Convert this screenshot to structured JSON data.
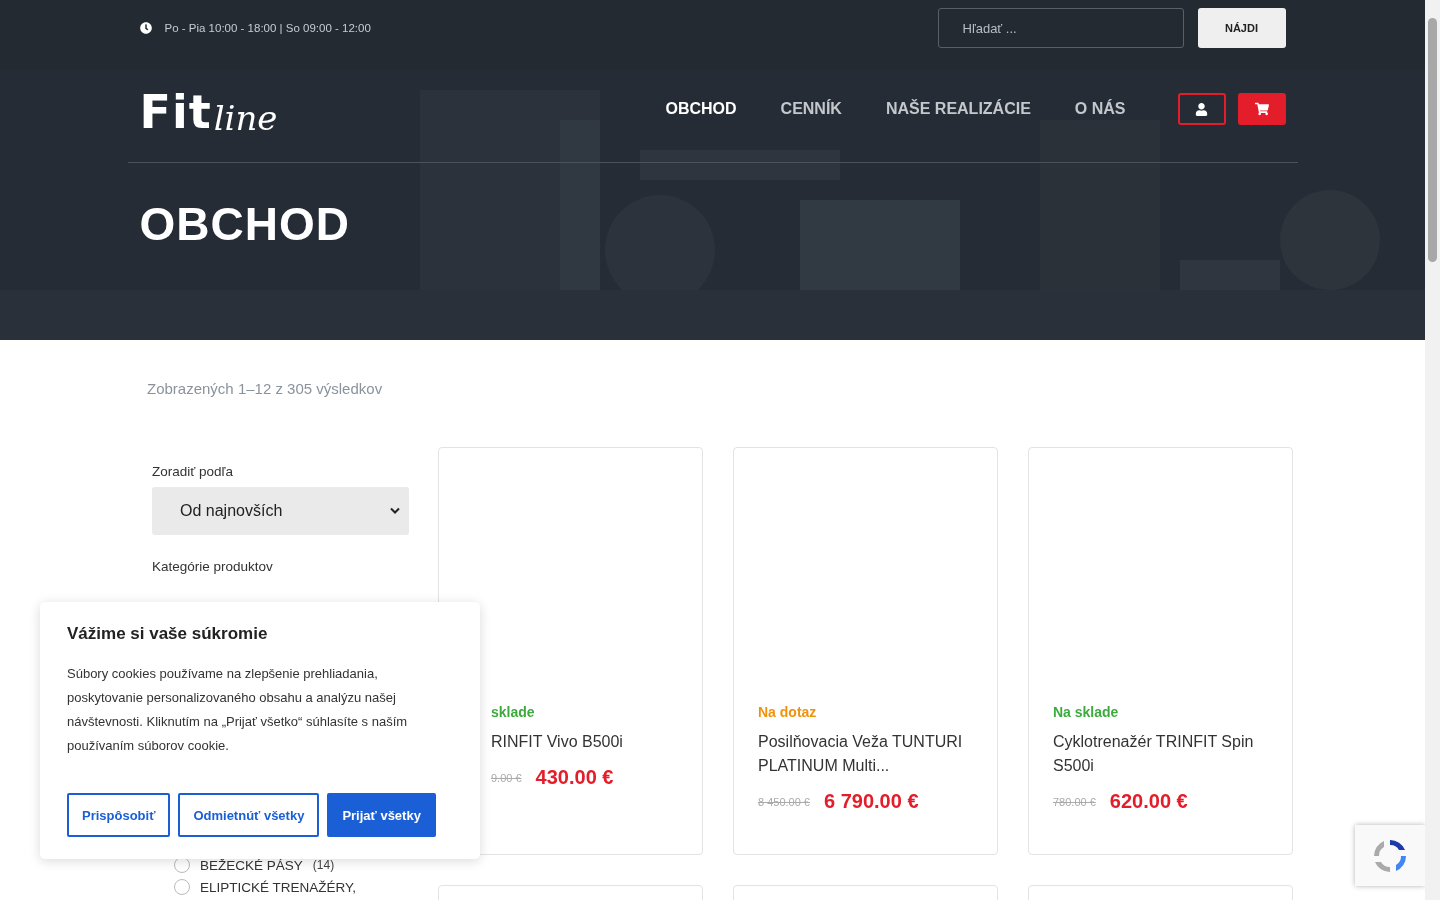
{
  "topbar": {
    "hours": "Po - Pia 10:00 - 18:00 | So 09:00 - 12:00",
    "search": {
      "placeholder": "Hľadať ..."
    },
    "search_button": "NÁJDI"
  },
  "nav": {
    "items": [
      {
        "label": "OBCHOD",
        "selected": true
      },
      {
        "label": "CENNÍK",
        "selected": false
      },
      {
        "label": "NAŠE REALIZÁCIE",
        "selected": false
      },
      {
        "label": "O NÁS",
        "selected": false
      }
    ]
  },
  "logo": {
    "bold": "Fit",
    "script": "line"
  },
  "hero": {
    "title": "OBCHOD"
  },
  "result_count": "Zobrazených 1–12 z 305 výsledkov",
  "sidebar": {
    "sort_label": "Zoradiť podľa",
    "sort_value": "Od najnovších",
    "categories_label": "Kategórie produktov",
    "categories": [
      {
        "name": "BEŽECKÉ PÁSY",
        "count": "(14)",
        "selected": false
      },
      {
        "name": "ELIPTICKÉ TRENAŽÉRY,",
        "selected": false
      }
    ]
  },
  "products": [
    {
      "status": "sklade",
      "kind": "in_stock",
      "name": "RINFIT Vivo B500i",
      "old_price": "9.00 €",
      "price": "430.00 €",
      "covered": true
    },
    {
      "status": "Na dotaz",
      "kind": "on_request",
      "name": "Posilňovacia Veža TUNTURI PLATINUM Multi...",
      "old_price": "8 450.00 €",
      "price": "6 790.00 €"
    },
    {
      "status": "Na sklade",
      "kind": "in_stock",
      "name": "Cyklotrenažér TRINFIT Spin S500i",
      "old_price": "780.00 €",
      "price": "620.00 €"
    }
  ],
  "cookie_dialog": {
    "title": "Vážime si vaše súkromie",
    "text": "Súbory cookies používame na zlepšenie prehliadania, poskytovanie personalizovaného obsahu a analýzu našej návštevnosti. Kliknutím na „Prijať všetko“ súhlasíte s naším používaním súborov cookie.",
    "buttons": [
      {
        "label": "Prispôsobiť",
        "kind": "outline"
      },
      {
        "label": "Odmietnúť všetky",
        "kind": "outline"
      },
      {
        "label": "Prijať všetky",
        "kind": "primary"
      }
    ]
  }
}
